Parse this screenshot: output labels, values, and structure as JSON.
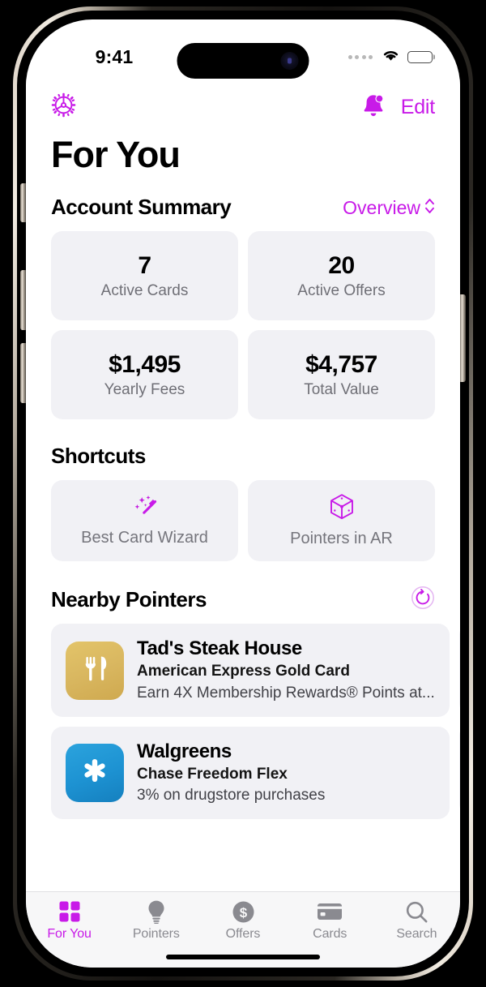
{
  "theme": {
    "accent": "#c81ae8",
    "card_bg": "#f1f1f5",
    "tabbar_bg": "#f7f7f8",
    "muted_text": "#6f6f76"
  },
  "status_bar": {
    "time": "9:41",
    "signal_icon": "signal-dots-icon",
    "wifi_icon": "wifi-icon",
    "battery_icon": "battery-icon"
  },
  "nav_bar": {
    "settings_icon": "gear-icon",
    "notifications_icon": "bell-badge-icon",
    "edit_label": "Edit"
  },
  "header": {
    "title": "For You"
  },
  "account_summary": {
    "title": "Account Summary",
    "action_label": "Overview",
    "action_icon": "chevron-up-down-icon",
    "stats": [
      {
        "value": "7",
        "label": "Active Cards"
      },
      {
        "value": "20",
        "label": "Active Offers"
      },
      {
        "value": "$1,495",
        "label": "Yearly Fees"
      },
      {
        "value": "$4,757",
        "label": "Total Value"
      }
    ]
  },
  "shortcuts": {
    "title": "Shortcuts",
    "items": [
      {
        "label": "Best Card Wizard",
        "icon": "magic-wand-icon"
      },
      {
        "label": "Pointers in AR",
        "icon": "ar-cube-icon"
      }
    ]
  },
  "nearby_pointers": {
    "title": "Nearby Pointers",
    "refresh_icon": "refresh-icon",
    "items": [
      {
        "name": "Tad's Steak House",
        "card": "American Express Gold Card",
        "detail": "Earn 4X Membership Rewards® Points at...",
        "icon": "fork-knife-icon",
        "icon_color": "#d9b760"
      },
      {
        "name": "Walgreens",
        "card": "Chase Freedom Flex",
        "detail": "3% on drugstore purchases",
        "icon": "asterisk-icon",
        "icon_color": "#1d92d2"
      }
    ]
  },
  "tab_bar": {
    "items": [
      {
        "label": "For You",
        "icon": "grid-squares-icon",
        "active": true
      },
      {
        "label": "Pointers",
        "icon": "lightbulb-icon",
        "active": false
      },
      {
        "label": "Offers",
        "icon": "dollar-circle-icon",
        "active": false
      },
      {
        "label": "Cards",
        "icon": "credit-card-icon",
        "active": false
      },
      {
        "label": "Search",
        "icon": "magnifier-icon",
        "active": false
      }
    ]
  }
}
